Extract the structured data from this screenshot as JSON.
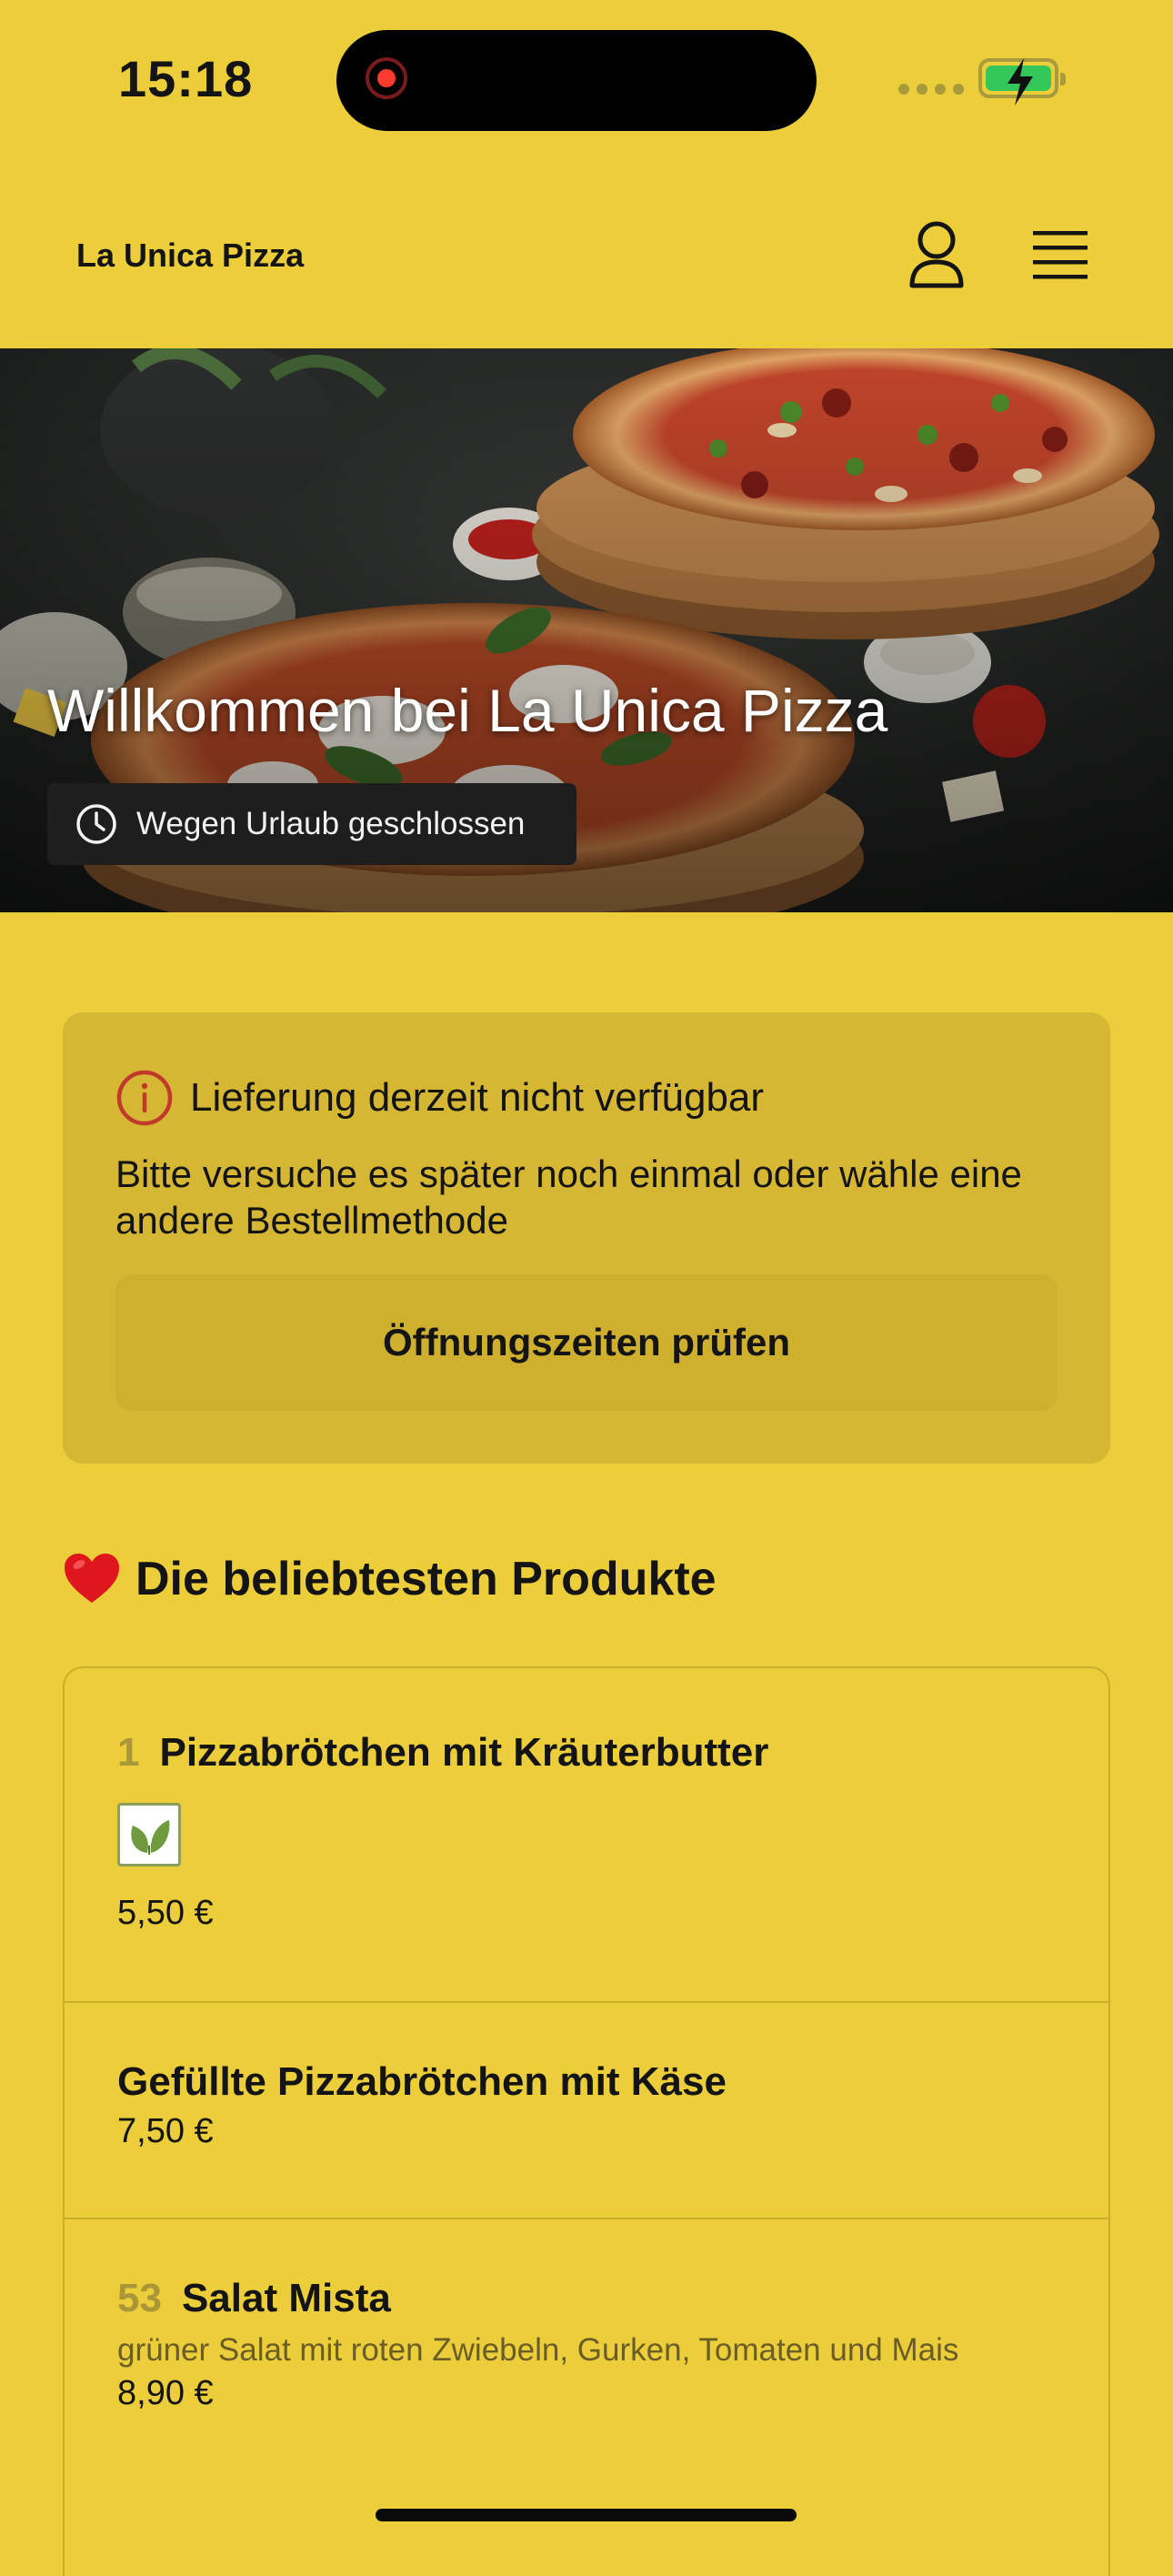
{
  "status_bar": {
    "time": "15:18"
  },
  "header": {
    "brand": "La Unica Pizza"
  },
  "hero": {
    "title": "Willkommen bei La Unica Pizza",
    "status_badge": "Wegen Urlaub geschlossen"
  },
  "notice": {
    "title": "Lieferung derzeit nicht verfügbar",
    "body": "Bitte versuche es später noch einmal oder wähle eine andere Bestellmethode",
    "button_label": "Öffnungszeiten prüfen"
  },
  "popular": {
    "emoji": "❤️",
    "title": "Die beliebtesten Produkte",
    "products": [
      {
        "number": "1",
        "name": "Pizzabrötchen mit Kräuterbutter",
        "price": "5,50 €",
        "badge": "leaf-icon"
      },
      {
        "number": "",
        "name": "Gefüllte Pizzabrötchen mit Käse",
        "price": "7,50 €"
      },
      {
        "number": "53",
        "name": "Salat Mista",
        "description": "grüner Salat mit roten Zwiebeln, Gurken, Tomaten und Mais",
        "price": "8,90 €"
      }
    ]
  }
}
